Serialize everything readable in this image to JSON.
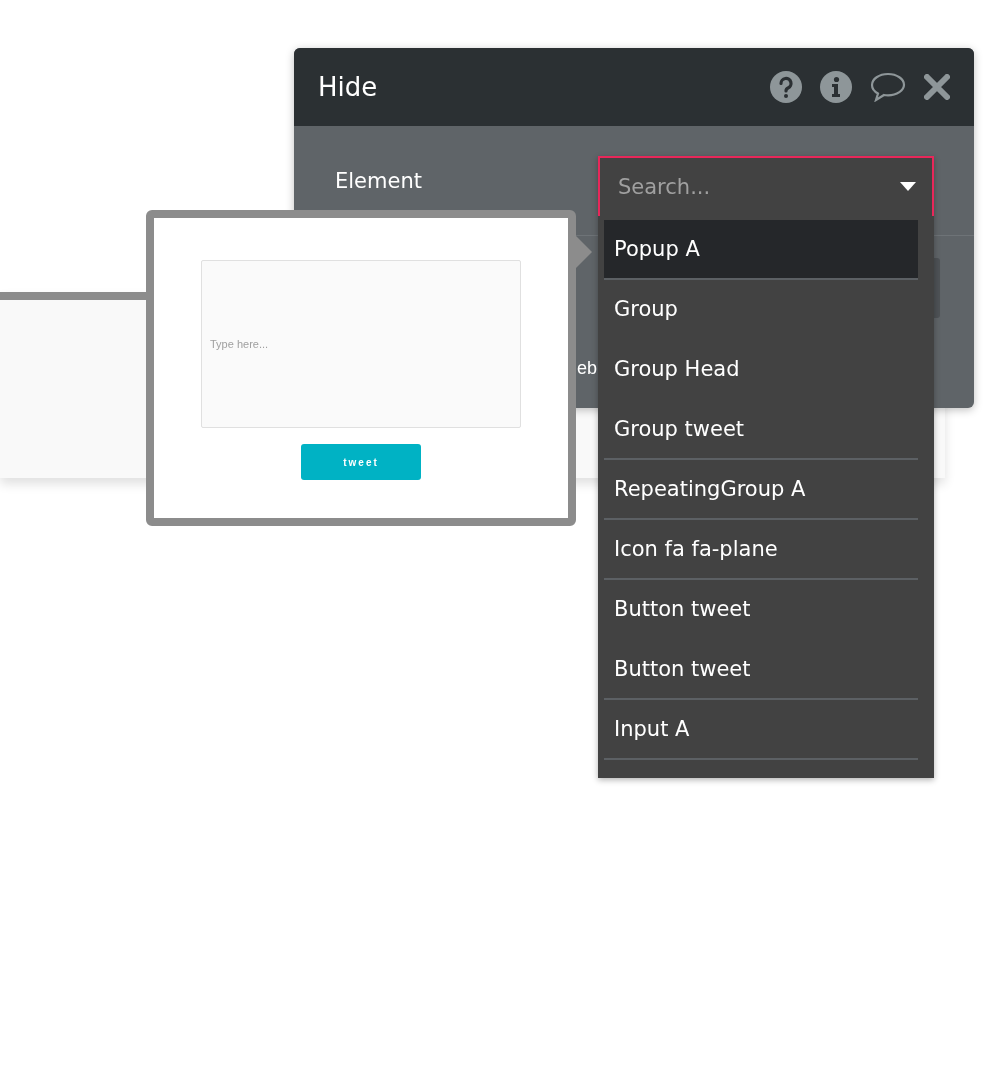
{
  "background_card": {
    "label_fragment": "eb"
  },
  "dialog": {
    "title": "Hide",
    "field_label": "Element"
  },
  "element_dropdown": {
    "placeholder": "Search...",
    "focused": true,
    "options": [
      {
        "label": "Popup A",
        "selected": true,
        "separated": true
      },
      {
        "label": "Group",
        "selected": false,
        "separated": false
      },
      {
        "label": "Group Head",
        "selected": false,
        "separated": false
      },
      {
        "label": "Group tweet",
        "selected": false,
        "separated": true
      },
      {
        "label": "RepeatingGroup A",
        "selected": false,
        "separated": true
      },
      {
        "label": "Icon fa fa-plane",
        "selected": false,
        "separated": true
      },
      {
        "label": "Button tweet",
        "selected": false,
        "separated": false
      },
      {
        "label": "Button tweet",
        "selected": false,
        "separated": true
      },
      {
        "label": "Input A",
        "selected": false,
        "separated": true
      }
    ]
  },
  "preview": {
    "input_placeholder": "Type here...",
    "button": "tweet"
  }
}
